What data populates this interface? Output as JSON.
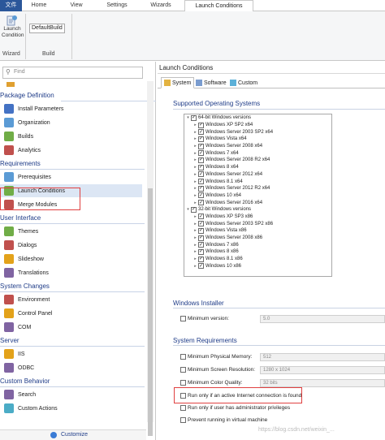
{
  "ribbon": {
    "file_tab": "文件",
    "tabs": [
      "Home",
      "View",
      "Settings",
      "Wizards",
      "Launch Conditions"
    ],
    "launch_condition_button": [
      "Launch",
      "Condition"
    ],
    "build_combo": "DefaultBuild",
    "groups": [
      "Wizard",
      "Build"
    ]
  },
  "nav": {
    "search_placeholder": "Find",
    "categories": [
      {
        "label": "Package Definition",
        "items": [
          "Install Parameters",
          "Organization",
          "Builds",
          "Analytics"
        ]
      },
      {
        "label": "Requirements",
        "items": [
          "Prerequisites",
          "Launch Conditions",
          "Merge Modules"
        ]
      },
      {
        "label": "User Interface",
        "items": [
          "Themes",
          "Dialogs",
          "Slideshow",
          "Translations"
        ]
      },
      {
        "label": "System Changes",
        "items": [
          "Environment",
          "Control Panel",
          "COM"
        ]
      },
      {
        "label": "Server",
        "items": [
          "IIS",
          "ODBC"
        ]
      },
      {
        "label": "Custom Behavior",
        "items": [
          "Search",
          "Custom Actions"
        ]
      }
    ],
    "selected": "Launch Conditions",
    "customize": "Customize"
  },
  "pane": {
    "title": "Launch Conditions",
    "tabs": [
      "System",
      "Software",
      "Custom"
    ],
    "os_section": "Supported Operating Systems",
    "os_groups": [
      {
        "label": "64-bit Windows versions",
        "items": [
          "Windows XP SP2 x64",
          "Windows Server 2003 SP2 x64",
          "Windows Vista x64",
          "Windows Server 2008 x64",
          "Windows 7 x64",
          "Windows Server 2008 R2 x64",
          "Windows 8 x64",
          "Windows Server 2012 x64",
          "Windows 8.1 x64",
          "Windows Server 2012 R2 x64",
          "Windows 10 x64",
          "Windows Server 2016 x64"
        ]
      },
      {
        "label": "32-bit Windows versions",
        "items": [
          "Windows XP SP3 x86",
          "Windows Server 2003 SP2 x86",
          "Windows Vista x86",
          "Windows Server 2008 x86",
          "Windows 7 x86",
          "Windows 8 x86",
          "Windows 8.1 x86",
          "Windows 10 x86"
        ]
      }
    ],
    "installer_section": "Windows Installer",
    "min_version_label": "Minimum version:",
    "min_version_value": "5.0",
    "sysreq_section": "System Requirements",
    "memory_label": "Minimum Physical Memory:",
    "memory_value": "512",
    "resolution_label": "Minimum Screen Resolution:",
    "resolution_value": "1280 x 1024",
    "color_label": "Minimum Color Quality:",
    "color_value": "32 bits",
    "internet_label": "Run only if an active Internet connection is found",
    "admin_label": "Run only if user has administrator privileges",
    "vm_label": "Prevent running in virtual machine"
  },
  "watermark": "https://blog.csdn.net/weixin_..."
}
